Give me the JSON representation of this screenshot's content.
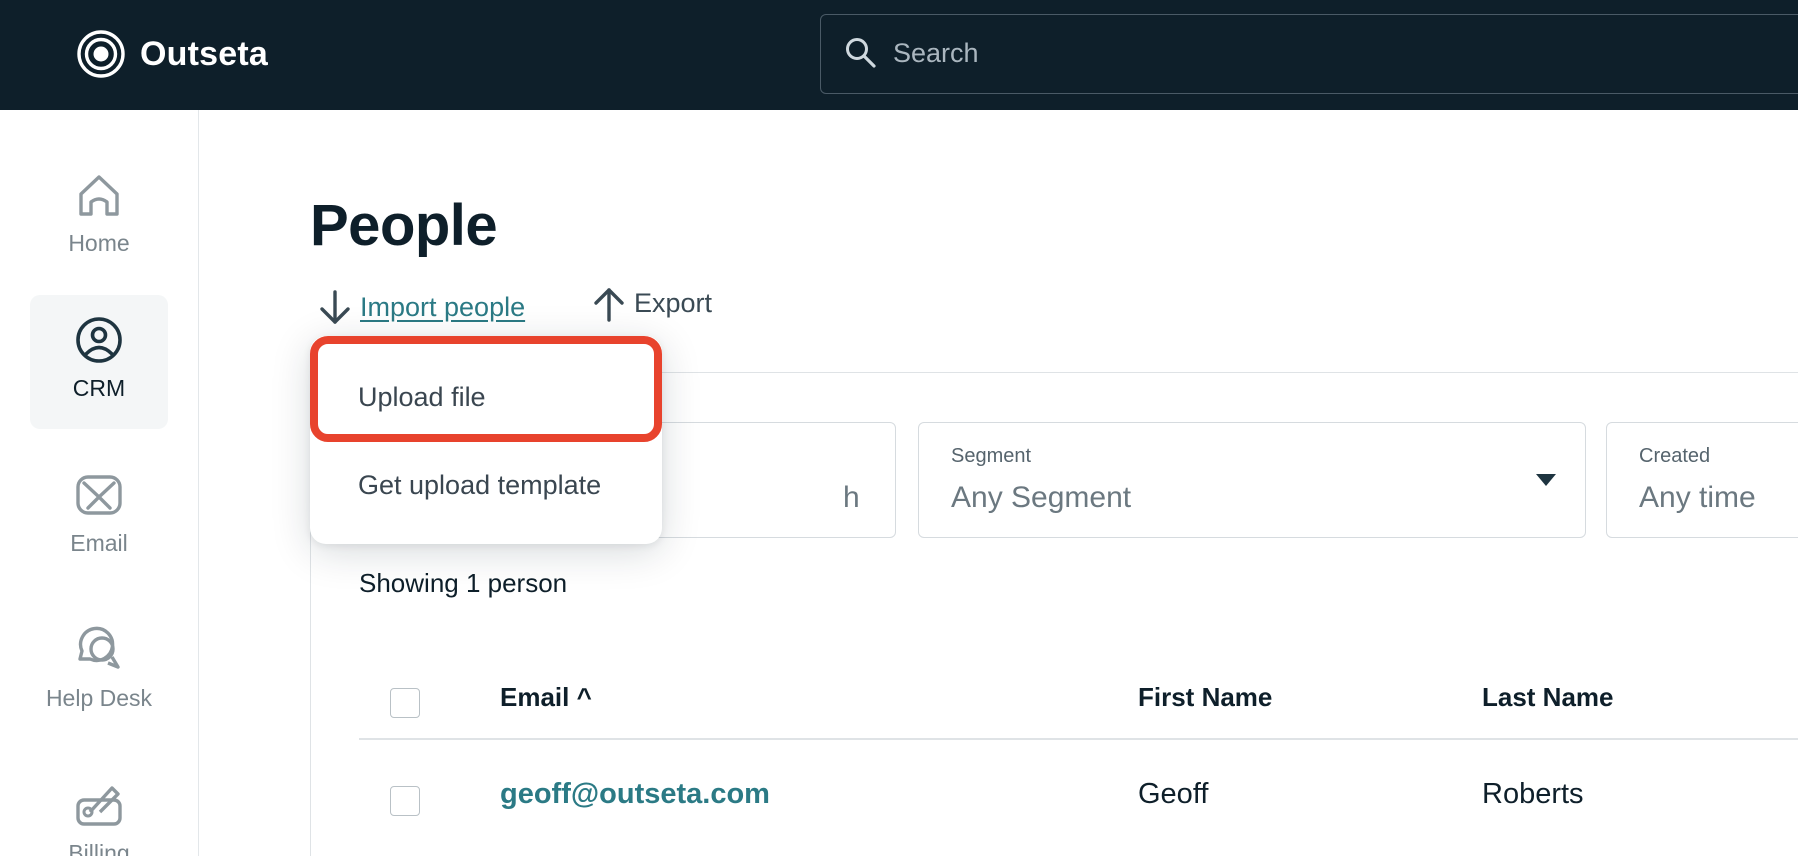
{
  "app": {
    "name": "Outseta"
  },
  "search": {
    "placeholder": "Search"
  },
  "sidebar": {
    "items": [
      {
        "label": "Home",
        "icon": "home-icon",
        "active": false
      },
      {
        "label": "CRM",
        "icon": "crm-icon",
        "active": true
      },
      {
        "label": "Email",
        "icon": "email-icon",
        "active": false
      },
      {
        "label": "Help Desk",
        "icon": "help-desk-icon",
        "active": false
      },
      {
        "label": "Billing",
        "icon": "billing-icon",
        "active": false
      }
    ]
  },
  "page": {
    "title": "People",
    "actions": {
      "import_label": "Import people",
      "export_label": "Export"
    }
  },
  "dropdown": {
    "items": [
      {
        "label": "Upload file",
        "highlighted": true
      },
      {
        "label": "Get upload template",
        "highlighted": false
      }
    ]
  },
  "filters": {
    "name": {
      "value_fragment": "h"
    },
    "segment": {
      "label": "Segment",
      "value": "Any Segment"
    },
    "created": {
      "label": "Created",
      "value": "Any time"
    }
  },
  "results": {
    "showing": "Showing 1 person"
  },
  "table": {
    "columns": {
      "email": "Email ^",
      "first_name": "First Name",
      "last_name": "Last Name"
    },
    "rows": [
      {
        "email": "geoff@outseta.com",
        "first_name": "Geoff",
        "last_name": "Roberts"
      }
    ]
  },
  "colors": {
    "topbar": "#0e1f2a",
    "accent_link": "#2b7a85",
    "highlight": "#e8432d"
  }
}
